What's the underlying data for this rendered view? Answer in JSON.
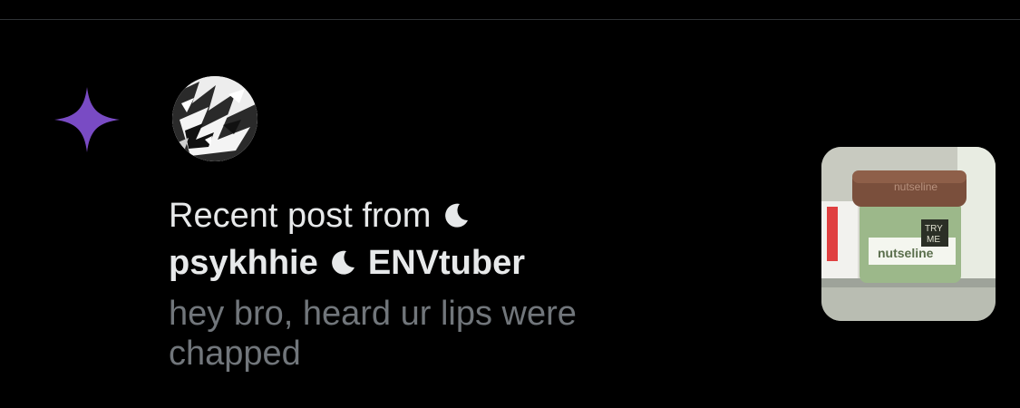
{
  "notification": {
    "intro_text": "Recent post from",
    "display_name_part1": "psykhhie",
    "display_name_part2": "ENVtuber",
    "preview_text": "hey bro, heard ur lips were chapped",
    "icon": "sparkle-icon",
    "moon_icon": "crescent-moon-icon"
  },
  "thumbnail": {
    "jar_lid_text": "nutseline",
    "jar_label_text": "nutseline",
    "tag_text_line1": "TRY",
    "tag_text_line2": "ME"
  },
  "colors": {
    "background": "#000000",
    "accent": "#794bc4",
    "primary_text": "#e7e9ea",
    "secondary_text": "#71767b",
    "divider": "#2f3336"
  }
}
